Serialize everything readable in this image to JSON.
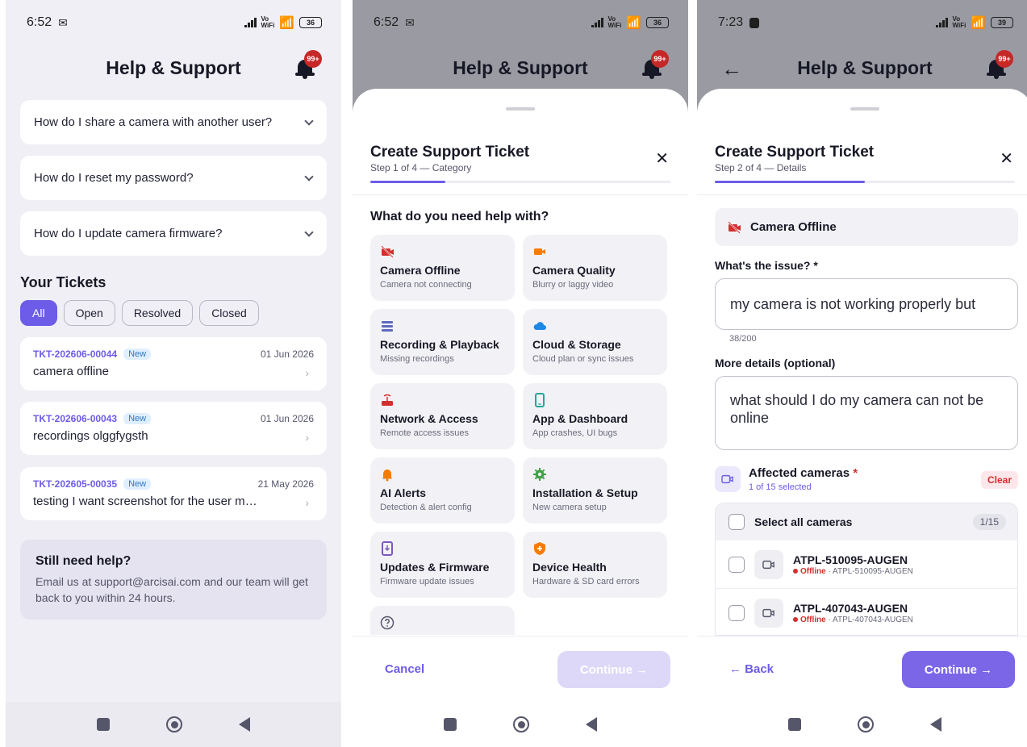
{
  "status1": {
    "time": "6:52",
    "battery": "36"
  },
  "status2": {
    "time": "6:52",
    "battery": "36"
  },
  "status3": {
    "time": "7:23",
    "battery": "39"
  },
  "vowifi": {
    "top": "Vo",
    "bottom": "WiFi"
  },
  "header": {
    "title": "Help & Support",
    "badge": "99+"
  },
  "faqs": [
    {
      "question": "How do I share a camera with another user?"
    },
    {
      "question": "How do I reset my password?"
    },
    {
      "question": "How do I update camera firmware?"
    }
  ],
  "tickets_section": {
    "title": "Your Tickets",
    "filters": [
      "All",
      "Open",
      "Resolved",
      "Closed"
    ],
    "active_filter": "All",
    "tickets": [
      {
        "id": "TKT-202606-00044",
        "status": "New",
        "date": "01 Jun 2026",
        "subject": "camera offline"
      },
      {
        "id": "TKT-202606-00043",
        "status": "New",
        "date": "01 Jun 2026",
        "subject": "recordings olggfygsth"
      },
      {
        "id": "TKT-202605-00035",
        "status": "New",
        "date": "21 May 2026",
        "subject": "testing I want screenshot for the user m…"
      }
    ]
  },
  "help_card": {
    "title": "Still need help?",
    "body": "Email us at support@arcisai.com and our team will get back to you within 24 hours."
  },
  "ticket_step1": {
    "title": "Create Support Ticket",
    "step": "Step 1 of 4 — Category",
    "progress": 0.25,
    "question": "What do you need help with?",
    "categories": [
      {
        "name": "Camera Offline",
        "desc": "Camera not connecting",
        "icon": "camera-off-icon",
        "color": "#d32f2f"
      },
      {
        "name": "Camera Quality",
        "desc": "Blurry or laggy video",
        "icon": "video-camera-icon",
        "color": "#f57c00"
      },
      {
        "name": "Recording & Playback",
        "desc": "Missing recordings",
        "icon": "list-icon",
        "color": "#5c6bc0"
      },
      {
        "name": "Cloud & Storage",
        "desc": "Cloud plan or sync issues",
        "icon": "cloud-icon",
        "color": "#1e88e5"
      },
      {
        "name": "Network & Access",
        "desc": "Remote access issues",
        "icon": "router-icon",
        "color": "#d32f2f"
      },
      {
        "name": "App & Dashboard",
        "desc": "App crashes, UI bugs",
        "icon": "phone-icon",
        "color": "#26a69a"
      },
      {
        "name": "AI Alerts",
        "desc": "Detection & alert config",
        "icon": "bell-icon",
        "color": "#f57c00"
      },
      {
        "name": "Installation & Setup",
        "desc": "New camera setup",
        "icon": "gear-icon",
        "color": "#43a047"
      },
      {
        "name": "Updates & Firmware",
        "desc": "Firmware update issues",
        "icon": "system-update-icon",
        "color": "#7e57c2"
      },
      {
        "name": "Device Health",
        "desc": "Hardware & SD card errors",
        "icon": "shield-icon",
        "color": "#f57c00"
      }
    ],
    "cancel_label": "Cancel",
    "continue_label": "Continue →"
  },
  "ticket_step2": {
    "title": "Create Support Ticket",
    "step": "Step 2 of 4 — Details",
    "progress": 0.5,
    "selected_category": "Camera Offline",
    "issue_label": "What's the issue? *",
    "issue_value": "my camera is not working properly but",
    "issue_counter": "38/200",
    "details_label": "More details (optional)",
    "details_value": "what should I do my camera can not be online",
    "affected_title": "Affected cameras",
    "affected_required": "*",
    "affected_sub": "1 of 15 selected",
    "clear_label": "Clear",
    "select_all_label": "Select all cameras",
    "select_count": "1/15",
    "cameras": [
      {
        "name": "ATPL-510095-AUGEN",
        "state": "Offline",
        "sep": "·",
        "id": "ATPL-510095-AUGEN"
      },
      {
        "name": "ATPL-407043-AUGEN",
        "state": "Offline",
        "sep": "·",
        "id": "ATPL-407043-AUGEN"
      }
    ],
    "back_label": "← Back",
    "continue_label": "Continue →"
  }
}
